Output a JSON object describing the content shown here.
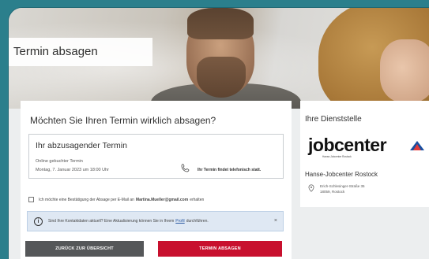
{
  "page": {
    "title": "Termin absagen"
  },
  "main": {
    "question": "Möchten Sie Ihren Termin wirklich absagen?",
    "appointment": {
      "heading": "Ihr abzusagender Termin",
      "type": "Online gebuchter Termin",
      "datetime": "Montag, 7. Januar 2023 um 18:00 Uhr",
      "phone_note": "Ihr Termin findet telefonisch statt."
    },
    "confirmation": {
      "label": "Ich möchte eine Bestätigung der Absage per E-Mail an",
      "email": "Martina.Mueller@gmail.com",
      "suffix": "erhalten",
      "checked": false
    },
    "info": {
      "text_before": "Sind Ihre Kontaktdaten aktuell? Eine Aktualisierung können Sie in Ihrem",
      "link": "Profil",
      "text_after": "durchführen.",
      "close": "×"
    },
    "buttons": {
      "back": "ZURÜCK ZUR ÜBERSICHT",
      "cancel": "TERMIN ABSAGEN"
    }
  },
  "sidebar": {
    "heading": "Ihre Dienststelle",
    "logo": {
      "wordmark": "jobcenter",
      "subline": "Hanse-Jobcenter Rostock"
    },
    "office_name": "Hanse-Jobcenter Rostock",
    "address_line1": "Erich-Schlesinger-Straße 35",
    "address_line2": "18059, Rostock"
  },
  "colors": {
    "accent": "#c8102e",
    "frame": "#2b7f8c",
    "button_secondary": "#555759",
    "info_bg": "#dfe8f3"
  },
  "icons": [
    "phone-icon",
    "info-icon",
    "close-icon",
    "location-pin-icon",
    "checkbox"
  ]
}
